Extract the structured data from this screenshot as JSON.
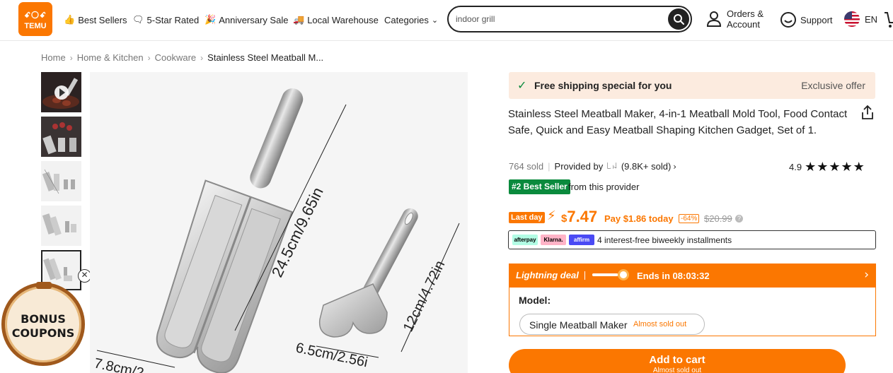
{
  "header": {
    "logo_line1": "ꗃ〇ꗃ",
    "logo_line2": "TEMU",
    "nav": [
      {
        "label": "Best Sellers",
        "icon": "thumbs-up-icon"
      },
      {
        "label": "5-Star Rated",
        "icon": "star-chat-icon"
      },
      {
        "label": "Anniversary Sale",
        "icon": "party-icon"
      },
      {
        "label": "Local Warehouse",
        "icon": "truck-icon"
      },
      {
        "label": "Categories",
        "icon": "chevron-down-icon"
      }
    ],
    "search_value": "indoor grill",
    "orders_line1": "Orders &",
    "orders_line2": "Account",
    "support": "Support",
    "language": "EN"
  },
  "breadcrumb": {
    "items": [
      "Home",
      "Home & Kitchen",
      "Cookware"
    ],
    "current": "Stainless Steel Meatball M..."
  },
  "coupon": {
    "line1": "BONUS",
    "line2": "COUPONS"
  },
  "image": {
    "dim_length": "24.5cm/9.65in",
    "dim_width": "7.8cm/2.",
    "dim_small_len": "12cm/4.72in",
    "dim_small_w": "6.5cm/2.56i"
  },
  "shipping": {
    "text": "Free shipping special for you",
    "offer": "Exclusive offer"
  },
  "product": {
    "title": "Stainless Steel Meatball Maker, 4-in-1 Meatball Mold Tool, Food Contact Safe, Quick and Easy Meatball Shaping Kitchen Gadget, Set of 1.",
    "sold": "764 sold",
    "provided_by": "Provided by",
    "provider_logo": "꒒ꈤ",
    "provider_sold": "(9.8K+ sold)",
    "rating": "4.9",
    "stars": "★★★★★",
    "best_seller": "#2 Best Seller",
    "best_from": "from this provider"
  },
  "price": {
    "last_day": "Last day",
    "currency": "$",
    "amount": "7.47",
    "pay_today": "Pay $1.86 today",
    "discount": "-64%",
    "original": "$20.99"
  },
  "installments": {
    "providers": [
      "afterpay",
      "Klarna.",
      "affirm"
    ],
    "text": "4 interest-free biweekly installments"
  },
  "lightning": {
    "label": "Lightning deal",
    "progress": 0.75,
    "ends": "Ends in 08:03:32"
  },
  "model": {
    "label": "Model:",
    "option": "Single Meatball Maker",
    "status": "Almost sold out"
  },
  "cart": {
    "label": "Add to cart",
    "sub": "Almost sold out"
  },
  "colors": {
    "brand": "#fb7701",
    "best_seller_green": "#0a8a3d"
  }
}
